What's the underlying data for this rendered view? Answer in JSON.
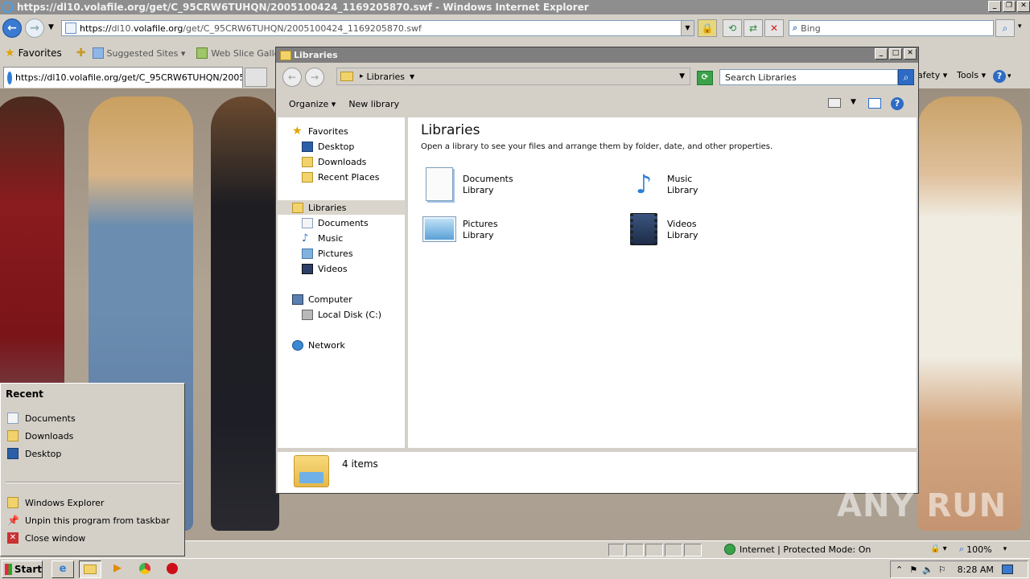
{
  "ie": {
    "title": "https://dl10.volafile.org/get/C_95CRW6TUHQN/2005100424_1169205870.swf - Windows Internet Explorer",
    "address_scheme": "https://",
    "address_host_prefix": "dl10.",
    "address_host": "volafile.org",
    "address_path": "/get/C_95CRW6TUHQN/2005100424_1169205870.swf",
    "search_placeholder": "Bing",
    "favorites_label": "Favorites",
    "suggested_sites_label": "Suggested Sites ▾",
    "web_slice_label": "Web Slice Gallery ▾",
    "tab_title": "https://dl10.volafile.org/get/C_95CRW6TUHQN/2005...",
    "safety_label": "afety ▾",
    "tools_label": "Tools ▾",
    "help_label": "?",
    "status_zone": "Internet | Protected Mode: On",
    "zoom": "100%"
  },
  "explorer": {
    "title": "Libraries",
    "breadcrumb": "Libraries",
    "search_placeholder": "Search Libraries",
    "cmd": {
      "organize": "Organize ▾",
      "new_library": "New library"
    },
    "nav": {
      "favorites": "Favorites",
      "desktop": "Desktop",
      "downloads": "Downloads",
      "recent_places": "Recent Places",
      "libraries": "Libraries",
      "documents": "Documents",
      "music": "Music",
      "pictures": "Pictures",
      "videos": "Videos",
      "computer": "Computer",
      "local_disk": "Local Disk (C:)",
      "network": "Network"
    },
    "main": {
      "heading": "Libraries",
      "subtitle": "Open a library to see your files and arrange them by folder, date, and other properties.",
      "libraries": [
        {
          "name": "Documents",
          "type": "Library",
          "icon": "documents-library-icon"
        },
        {
          "name": "Music",
          "type": "Library",
          "icon": "music-library-icon"
        },
        {
          "name": "Pictures",
          "type": "Library",
          "icon": "pictures-library-icon"
        },
        {
          "name": "Videos",
          "type": "Library",
          "icon": "videos-library-icon"
        }
      ]
    },
    "details": {
      "count": "4 items"
    }
  },
  "jumplist": {
    "heading": "Recent",
    "recent": [
      "Documents",
      "Downloads",
      "Desktop"
    ],
    "tasks": [
      "Windows Explorer",
      "Unpin this program from taskbar",
      "Close window"
    ]
  },
  "taskbar": {
    "start": "Start",
    "clock": "8:28 AM"
  },
  "watermark": "ANY RUN",
  "colors": {
    "accent": "#2d6bc4",
    "titlebar": "#8e8e8e"
  }
}
